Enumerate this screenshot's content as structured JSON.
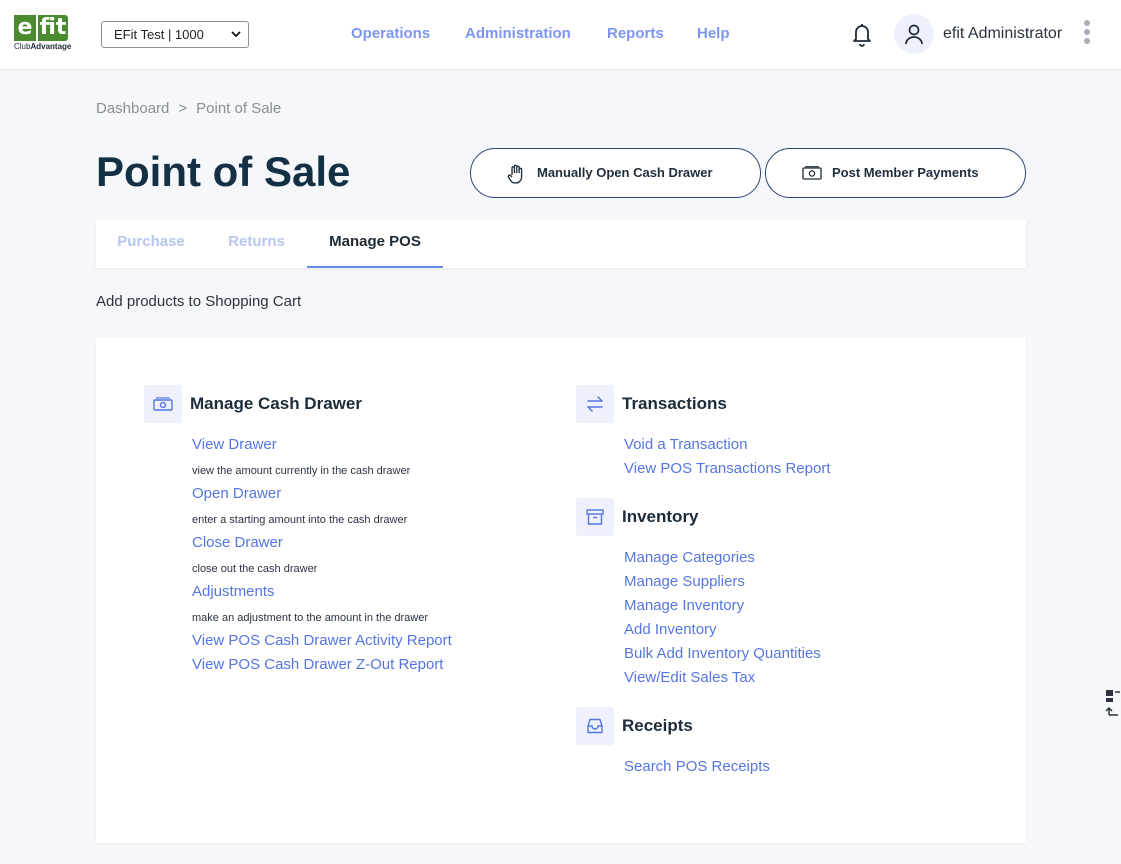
{
  "header": {
    "logo_mark_e": "e",
    "logo_mark_fit": "fit",
    "logo_sub_club": "Club",
    "logo_sub_advantage": "Advantage",
    "club_select_value": "EFit Test | 1000",
    "nav": [
      "Operations",
      "Administration",
      "Reports",
      "Help"
    ],
    "user_name": "efit Administrator"
  },
  "breadcrumb": {
    "home": "Dashboard",
    "separator": ">",
    "current": "Point of Sale"
  },
  "page": {
    "title": "Point of Sale",
    "open_drawer_button": "Manually Open Cash Drawer",
    "post_payments_button": "Post Member Payments",
    "subtitle": "Add products to Shopping Cart"
  },
  "tabs": {
    "purchase": "Purchase",
    "returns": "Returns",
    "manage_pos": "Manage POS",
    "active": "Manage POS"
  },
  "sections": {
    "cash_drawer": {
      "title": "Manage Cash Drawer",
      "items": [
        {
          "link": "View Drawer",
          "desc": "view the amount currently in the cash drawer"
        },
        {
          "link": "Open Drawer",
          "desc": "enter a starting amount into the cash drawer"
        },
        {
          "link": "Close Drawer",
          "desc": "close out the cash drawer"
        },
        {
          "link": "Adjustments",
          "desc": "make an adjustment to the amount in the drawer"
        },
        {
          "link": "View POS Cash Drawer Activity Report"
        },
        {
          "link": "View POS Cash Drawer Z-Out Report"
        }
      ]
    },
    "transactions": {
      "title": "Transactions",
      "links": [
        "Void a Transaction",
        "View POS Transactions Report"
      ]
    },
    "inventory": {
      "title": "Inventory",
      "links": [
        "Manage Categories",
        "Manage Suppliers",
        "Manage Inventory",
        "Add Inventory",
        "Bulk Add Inventory Quantities",
        "View/Edit Sales Tax"
      ]
    },
    "receipts": {
      "title": "Receipts",
      "links": [
        "Search POS Receipts"
      ]
    }
  },
  "icons": {
    "logo": "efit-logo",
    "select_chevron": "chevron-down-icon",
    "notifications": "bell-icon",
    "user": "user-icon",
    "more": "kebab-menu-icon",
    "open_drawer": "hand-icon",
    "post_payments": "cash-icon",
    "cash_drawer": "cash-icon",
    "transactions": "arrows-exchange-icon",
    "inventory": "archive-box-icon",
    "receipts": "inbox-tray-icon"
  },
  "colors": {
    "brand_green": "#4b8b2f",
    "nav_link": "#7c96f0",
    "link": "#5576e0",
    "title_dark": "#133045",
    "tab_inactive": "#b8c5ef",
    "tab_underline": "#6d8ae6",
    "background": "#f5f7fa"
  }
}
